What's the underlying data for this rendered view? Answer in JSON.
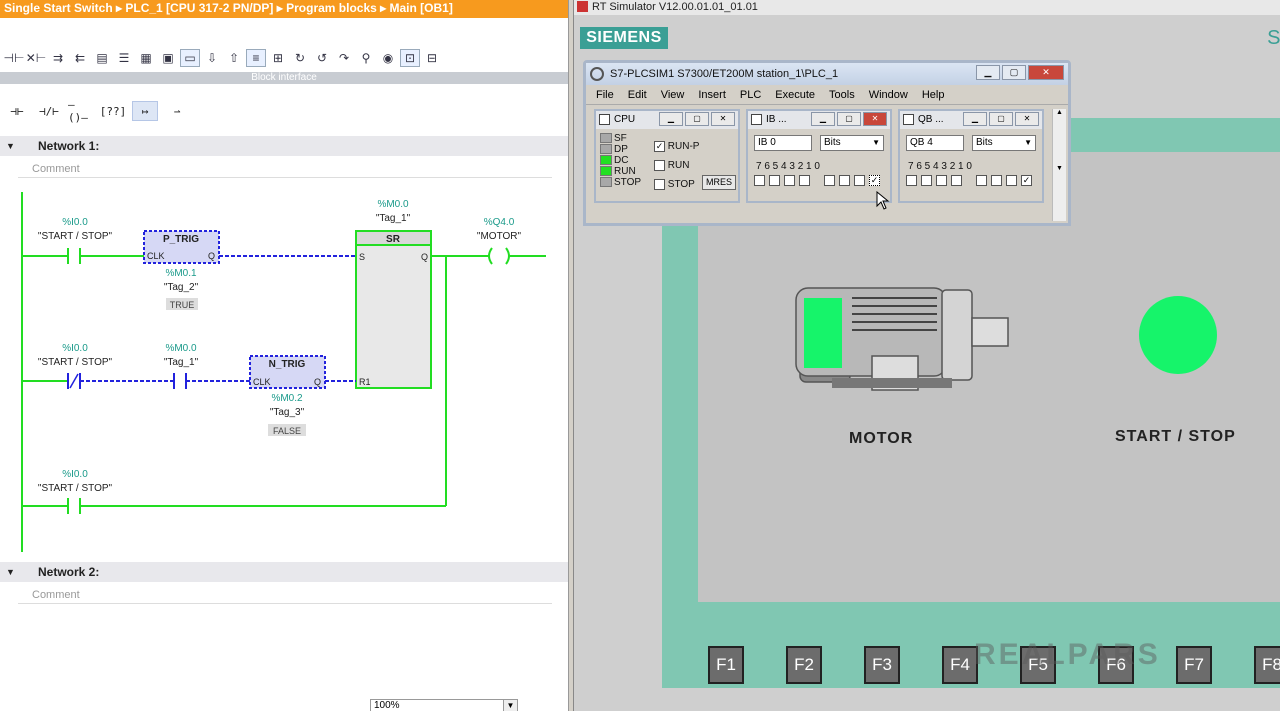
{
  "editor": {
    "breadcrumb": "Single Start Switch  ▸  PLC_1 [CPU 317-2 PN/DP]  ▸  Program blocks  ▸  Main [OB1]",
    "block_interface": "Block interface",
    "network1_title": "Network 1:",
    "network2_title": "Network 2:",
    "comment_placeholder": "Comment",
    "zoom": "100%"
  },
  "ladder": {
    "contact1_addr": "%I0.0",
    "contact1_tag": "\"START / STOP\"",
    "ptrig_name": "P_TRIG",
    "ptrig_clk": "CLK",
    "ptrig_q": "Q",
    "ptrig_bit_addr": "%M0.1",
    "ptrig_bit_tag": "\"Tag_2\"",
    "ptrig_status": "TRUE",
    "sr_addr": "%M0.0",
    "sr_tag": "\"Tag_1\"",
    "sr_name": "SR",
    "sr_s": "S",
    "sr_q": "Q",
    "sr_r1": "R1",
    "coil_addr": "%Q4.0",
    "coil_tag": "\"MOTOR\"",
    "contact2_addr": "%I0.0",
    "contact2_tag": "\"START / STOP\"",
    "contact3_addr": "%M0.0",
    "contact3_tag": "\"Tag_1\"",
    "ntrig_name": "N_TRIG",
    "ntrig_clk": "CLK",
    "ntrig_q": "Q",
    "ntrig_bit_addr": "%M0.2",
    "ntrig_bit_tag": "\"Tag_3\"",
    "ntrig_status": "FALSE",
    "contact4_addr": "%I0.0",
    "contact4_tag": "\"START / STOP\""
  },
  "simulator": {
    "window_title": "RT Simulator V12.00.01.01_01.01",
    "brand": "SIEMENS",
    "brand_right": "SI",
    "motor_label": "MOTOR",
    "startstop_label": "START / STOP",
    "fkeys": [
      "F1",
      "F2",
      "F3",
      "F4",
      "F5",
      "F6",
      "F7",
      "F8"
    ],
    "watermark": "REALPARS",
    "lamp_color": "#16f46a"
  },
  "plcsim": {
    "title": "S7-PLCSIM1    S7300/ET200M station_1\\PLC_1",
    "menu": [
      "File",
      "Edit",
      "View",
      "Insert",
      "PLC",
      "Execute",
      "Tools",
      "Window",
      "Help"
    ],
    "cpu_title": "CPU",
    "leds": [
      "SF",
      "DP",
      "DC",
      "RUN",
      "STOP"
    ],
    "mode_runp": "RUN-P",
    "mode_run": "RUN",
    "mode_stop": "STOP",
    "mres": "MRES",
    "ib_title": "IB ...",
    "ib_field": "IB    0",
    "ib_format": "Bits",
    "ib_bits": "7  6  5  4      3  2  1  0",
    "qb_title": "QB ...",
    "qb_field": "QB    4",
    "qb_format": "Bits",
    "qb_bits": "7  6  5  4      3  2  1  0"
  },
  "colors": {
    "orange_title": "#f79a1e",
    "rung_green": "#22dd22",
    "rung_blue": "#2222dd",
    "addr_teal": "#1a9a8a",
    "teal_frame": "#80c7b2"
  }
}
